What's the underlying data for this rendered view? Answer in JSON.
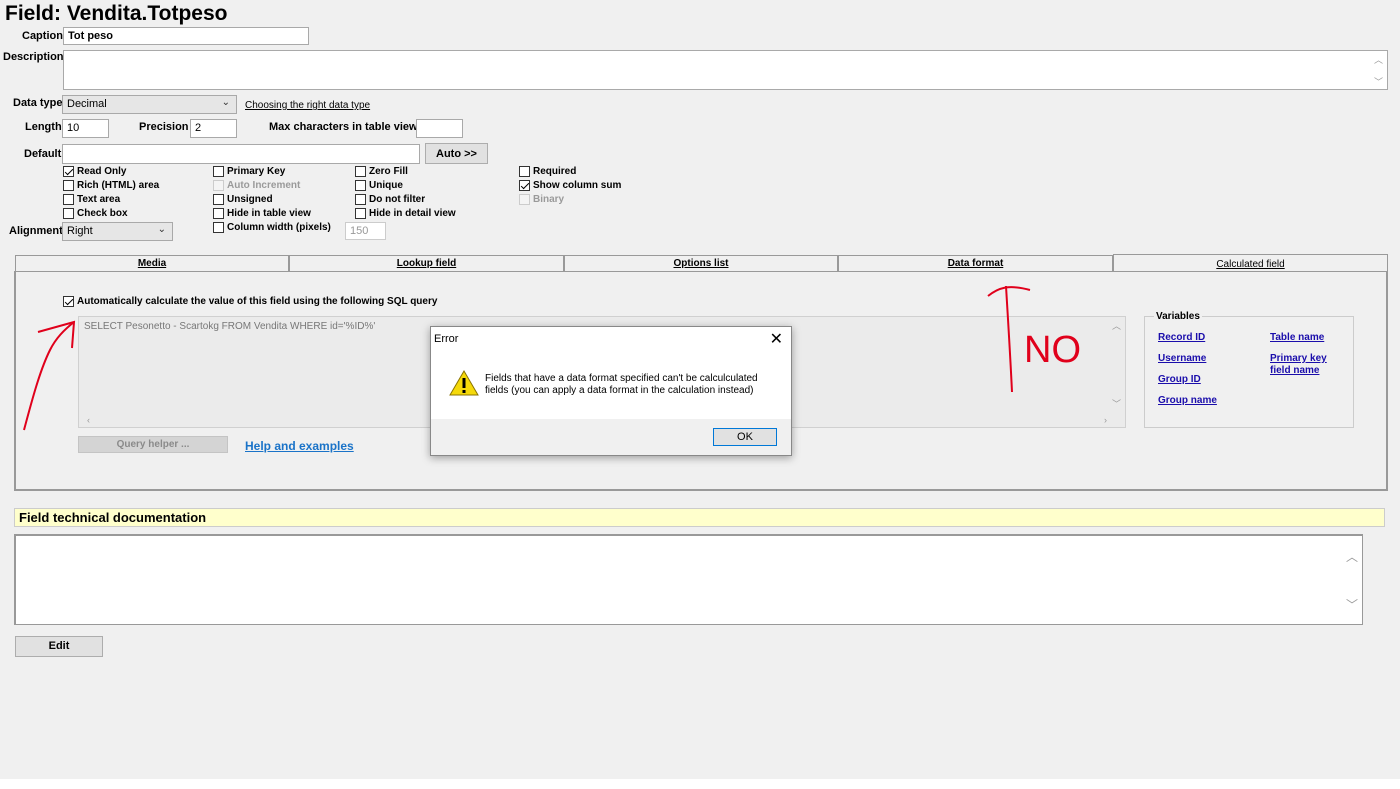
{
  "page": {
    "title": "Field: Vendita.Totpeso"
  },
  "form": {
    "caption_label": "Caption",
    "caption_value": "Tot peso",
    "description_label": "Description",
    "data_type_label": "Data type",
    "data_type_value": "Decimal",
    "data_type_link": "Choosing the right data type",
    "length_label": "Length",
    "length_value": "10",
    "precision_label": "Precision",
    "precision_value": "2",
    "max_chars_label": "Max characters in table view",
    "default_label": "Default",
    "auto_button": "Auto >>",
    "alignment_label": "Alignment",
    "alignment_value": "Right",
    "column_width_label": "Column width (pixels)",
    "column_width_value": "150"
  },
  "checkboxes": {
    "read_only": "Read Only",
    "rich_html": "Rich (HTML) area",
    "text_area": "Text area",
    "check_box": "Check box",
    "primary_key": "Primary Key",
    "auto_increment": "Auto Increment",
    "unsigned": "Unsigned",
    "hide_table": "Hide in table view",
    "zero_fill": "Zero Fill",
    "unique": "Unique",
    "do_not_filter": "Do not filter",
    "hide_detail": "Hide in detail view",
    "required": "Required",
    "show_column_sum": "Show column sum",
    "binary": "Binary"
  },
  "tabs": [
    "Media",
    "Lookup field",
    "Options list",
    "Data format",
    "Calculated field"
  ],
  "calc": {
    "auto_calc_label": "Automatically calculate the value of this field using the following SQL query",
    "sql": "SELECT Pesonetto - Scartokg FROM Vendita WHERE id='%ID%'",
    "query_helper": "Query helper ...",
    "help_link": "Help and examples",
    "variables_title": "Variables",
    "vars": [
      "Record ID",
      "Username",
      "Group ID",
      "Group name",
      "Table name",
      "Primary key",
      "field name"
    ]
  },
  "dialog": {
    "title": "Error",
    "message_line1": "Fields that have a data format specified can't be calculculated",
    "message_line2": "fields (you can apply a data format in the calculation instead)",
    "ok": "OK"
  },
  "doc": {
    "header": "Field technical documentation",
    "edit_button": "Edit"
  },
  "annotation": {
    "text": "NO"
  },
  "colors": {
    "link": "#1a0dab",
    "doc_header_bg": "#ffffcc",
    "annotation": "#e0001b",
    "warning": "#f5d90a"
  }
}
